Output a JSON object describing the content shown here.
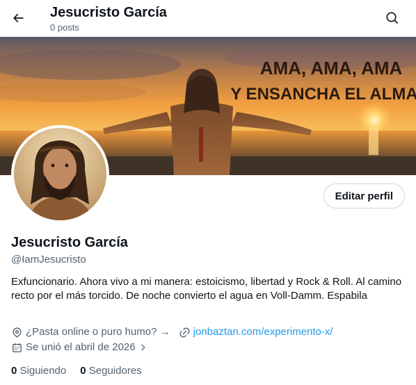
{
  "header": {
    "title": "Jesucristo García",
    "subtitle": "0 posts"
  },
  "banner": {
    "line1": "AMA, AMA, AMA",
    "line2": "Y ENSANCHA EL ALMA"
  },
  "actions": {
    "edit_label": "Editar perfil"
  },
  "profile": {
    "name": "Jesucristo García",
    "handle": "@IamJesucristo",
    "bio": "Exfuncionario. Ahora vivo a mi manera: estoicismo, libertad y Rock & Roll. Al camino recto por el más torcido. De noche convierto el agua en Voll-Damm. Espabila",
    "location": "¿Pasta online o puro humo? →",
    "website": "jonbaztan.com/experimento-x/",
    "joined": "Se unió el abril de 2026"
  },
  "stats": {
    "following_count": "0",
    "following_label": "Siguiendo",
    "followers_count": "0",
    "followers_label": "Seguidores"
  },
  "colors": {
    "accent": "#1d9bf0",
    "secondary_text": "#536471",
    "border": "#cfd9de"
  },
  "icons": {
    "back": "arrow-left-icon",
    "search": "search-icon",
    "location": "location-pin-icon",
    "link": "link-icon",
    "calendar": "calendar-icon",
    "chevron": "chevron-right-icon"
  }
}
